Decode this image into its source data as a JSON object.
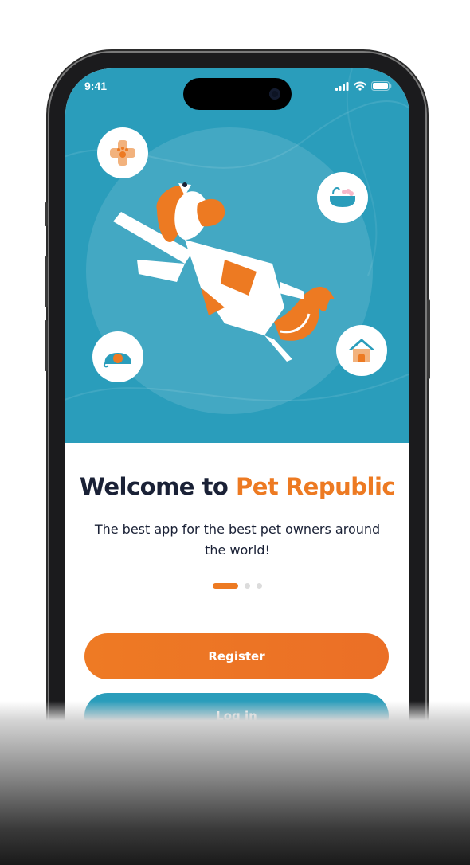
{
  "status_bar": {
    "time": "9:41",
    "icons": [
      "signal-icon",
      "wifi-icon",
      "battery-icon"
    ]
  },
  "hero": {
    "illustration": "jumping-dog",
    "icons": [
      "paw-bandage-icon",
      "bathtub-icon",
      "leash-icon",
      "doghouse-icon"
    ]
  },
  "welcome": {
    "title_prefix": "Welcome to ",
    "title_brand": "Pet Republic",
    "subtitle": "The best app for the best pet owners around the world!"
  },
  "pager": {
    "count": 3,
    "active": 0
  },
  "actions": {
    "register_label": "Register",
    "login_label": "Log in"
  },
  "colors": {
    "accent": "#ed7a22",
    "teal": "#2a9dbb",
    "text_dark": "#1a2136",
    "white": "#ffffff"
  }
}
